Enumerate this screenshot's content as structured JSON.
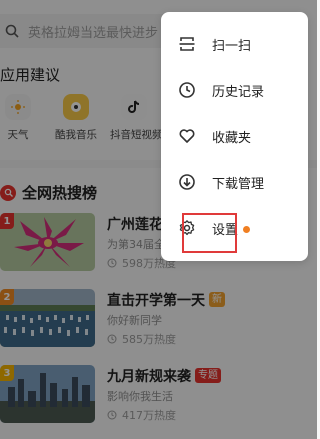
{
  "search": {
    "placeholder": "英格拉姆当选最快进步"
  },
  "apps": {
    "title": "应用建议",
    "items": [
      {
        "label": "天气",
        "icon": "weather-icon"
      },
      {
        "label": "酷我音乐",
        "icon": "kuwo-music-icon"
      },
      {
        "label": "抖音短视频",
        "icon": "douyin-icon"
      }
    ]
  },
  "hot": {
    "title": "全网热搜榜",
    "items": [
      {
        "rank": "1",
        "title": "广州莲花",
        "subtitle": "为第34届全",
        "heat": "598万热度",
        "rank_color": "#e5322d",
        "badge": ""
      },
      {
        "rank": "2",
        "title": "直击开学第一天",
        "subtitle": "你好新同学",
        "heat": "585万热度",
        "rank_color": "#f08a24",
        "badge": "新",
        "badge_color": "#f0a030"
      },
      {
        "rank": "3",
        "title": "九月新规来袭",
        "subtitle": "影响你我生活",
        "heat": "417万热度",
        "rank_color": "#f5b400",
        "badge": "专题",
        "badge_color": "#e5322d"
      }
    ]
  },
  "menu": {
    "items": [
      {
        "label": "扫一扫",
        "icon": "scan-icon"
      },
      {
        "label": "历史记录",
        "icon": "clock-icon"
      },
      {
        "label": "收藏夹",
        "icon": "heart-icon"
      },
      {
        "label": "下载管理",
        "icon": "download-icon"
      },
      {
        "label": "设置",
        "icon": "gear-icon",
        "has_dot": true
      }
    ]
  },
  "colors": {
    "accent_red": "#e03a3a",
    "notify_dot": "#f07f22"
  }
}
